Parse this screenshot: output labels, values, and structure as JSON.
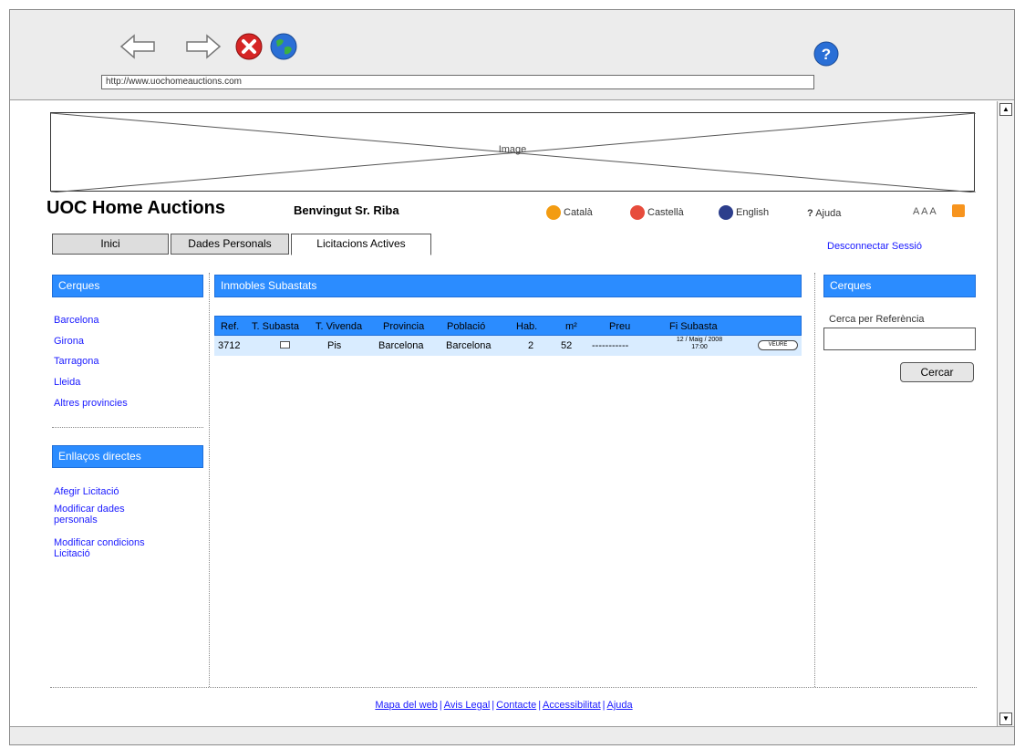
{
  "browser": {
    "url": "http://www.uochomeauctions.com"
  },
  "banner": {
    "label": "Image"
  },
  "site": {
    "title": "UOC Home Auctions",
    "welcome": "Benvingut Sr. Riba"
  },
  "languages": [
    {
      "label": "Català",
      "flag_color": "#f39c12"
    },
    {
      "label": "Castellà",
      "flag_color": "#e74c3c"
    },
    {
      "label": "English",
      "flag_color": "#2c3e8c"
    }
  ],
  "help_label": "Ajuda",
  "font_size_label": "A A A",
  "tabs": [
    {
      "label": "Inici"
    },
    {
      "label": "Dades Personals"
    },
    {
      "label": "Licitacions Actives"
    }
  ],
  "logout_label": "Desconnectar Sessió",
  "left_sidebar": {
    "search_title": "Cerques",
    "search_links": [
      "Barcelona",
      "Girona",
      "Tarragona",
      "Lleida",
      "Altres provincies"
    ],
    "links_title": "Enllaços directes",
    "direct_links": [
      "Afegir Licitació",
      "Modificar dades personals",
      "Modificar condicions Licitació"
    ]
  },
  "main": {
    "title": "Inmobles Subastats",
    "columns": [
      "Ref.",
      "T. Subasta",
      "T. Vivenda",
      "Provincia",
      "Població",
      "Hab.",
      "m²",
      "Preu",
      "Fi Subasta"
    ],
    "rows": [
      {
        "ref": "3712",
        "vivenda": "Pis",
        "provincia": "Barcelona",
        "poblacio": "Barcelona",
        "hab": "2",
        "m2": "52",
        "preu": "-----------",
        "fi_subasta_date": "12 / Maig / 2008",
        "fi_subasta_time": "17:00",
        "view_label": "VEURE"
      }
    ]
  },
  "right_sidebar": {
    "title": "Cerques",
    "search_label": "Cerca per Referència",
    "search_button": "Cercar"
  },
  "footer": {
    "links": [
      "Mapa del web",
      "Avis Legal",
      "Contacte",
      "Accessibilitat",
      "Ajuda"
    ]
  },
  "colors": {
    "section_blue": "#2b8cff",
    "link_blue": "#1a1aff",
    "row_highlight": "#d9ecff"
  }
}
